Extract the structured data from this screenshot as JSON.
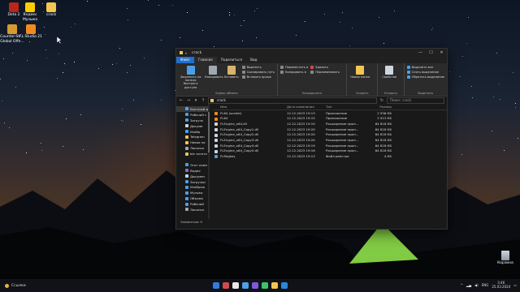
{
  "desktop": {
    "icons": [
      {
        "label": "Dota 2",
        "color": "#b8261c"
      },
      {
        "label": "Яндекс Музыка",
        "color": "#ffcc00"
      },
      {
        "label": "crack",
        "color": "#f3c64f"
      },
      {
        "label": "Counter-Str... Global Offe...",
        "color": "#d79a2e"
      },
      {
        "label": "FL Studio 21",
        "color": "#f08a1f"
      }
    ],
    "recycle_bin": "Корзина"
  },
  "window": {
    "title": "crack",
    "tabs": [
      "Файл",
      "Главная",
      "Поделиться",
      "Вид"
    ],
    "ribbon": {
      "clipboard": {
        "pin": "Закрепить на панели быстрого доступа",
        "copy": "Копировать",
        "paste": "Вставить",
        "cut": "Вырезать",
        "copy_path": "Скопировать путь",
        "paste_shortcut": "Вставить ярлык",
        "group": "Буфер обмена"
      },
      "organize": {
        "move_to": "Переместить в",
        "copy_to": "Копировать в",
        "delete": "Удалить",
        "rename": "Переименовать",
        "group": "Упорядочить"
      },
      "new": {
        "new_folder": "Новая папка",
        "group": "Создать"
      },
      "open": {
        "properties": "Свойства",
        "group": "Открыть"
      },
      "select": {
        "select_all": "Выделить все",
        "select_none": "Снять выделение",
        "invert": "Обратить выделение",
        "group": "Выделить"
      }
    },
    "address": {
      "path": "crack",
      "search_placeholder": "Поиск: crack"
    },
    "nav_pane": [
      {
        "label": "Быстрый д",
        "color": "#4fa3ff",
        "sel": true
      },
      {
        "label": "Рабочий с",
        "color": "#4aa0e8"
      },
      {
        "label": "Загрузк",
        "color": "#4aa0e8"
      },
      {
        "label": "Докуме",
        "color": "#cfd6de"
      },
      {
        "label": "Изобр",
        "color": "#4aa0e8"
      },
      {
        "label": "Telegram",
        "color": "#f3c64f"
      },
      {
        "label": "Новая па",
        "color": "#f3c64f"
      },
      {
        "label": "Локальн",
        "color": "#a0a8b0"
      },
      {
        "label": "bin загото",
        "color": "#f3c64f"
      },
      {
        "label": "",
        "color": "#191919"
      },
      {
        "label": "Этот комп",
        "color": "#4aa0e8"
      },
      {
        "label": "Видео",
        "color": "#8e6bd6"
      },
      {
        "label": "Докумен",
        "color": "#cfd6de"
      },
      {
        "label": "Загрузки",
        "color": "#4aa0e8"
      },
      {
        "label": "Изображ",
        "color": "#4aa0e8"
      },
      {
        "label": "Музыка",
        "color": "#4aa0e8"
      },
      {
        "label": "Объемн",
        "color": "#4aa0e8"
      },
      {
        "label": "Рабочий",
        "color": "#4aa0e8"
      },
      {
        "label": "Локальн",
        "color": "#a0a8b0"
      }
    ],
    "columns": {
      "name": "Имя",
      "date": "Дата изменения",
      "type": "Тип",
      "size": "Размер"
    },
    "files": [
      {
        "name": "FL64 (scaled)",
        "date": "12.12.2023 19:13",
        "type": "Приложение",
        "size": "2 936 КБ",
        "color": "#f08a1f"
      },
      {
        "name": "FL64",
        "date": "12.12.2023 19:15",
        "type": "Приложение",
        "size": "2 913 КБ",
        "color": "#f08a1f"
      },
      {
        "name": "FLEngine_x64.dll",
        "date": "12.12.2023 19:19",
        "type": "Расширение прил...",
        "size": "64 818 КБ",
        "color": "#cfd6de"
      },
      {
        "name": "FLEngine_x64_Copy1.dll",
        "date": "12.12.2023 19:20",
        "type": "Расширение прил...",
        "size": "64 818 КБ",
        "color": "#cfd6de"
      },
      {
        "name": "FLEngine_x64_Copy2.dll",
        "date": "12.12.2023 19:20",
        "type": "Расширение прил...",
        "size": "64 818 КБ",
        "color": "#cfd6de"
      },
      {
        "name": "FLEngine_x64_Copy3.dll",
        "date": "12.12.2023 19:20",
        "type": "Расширение прил...",
        "size": "64 818 КБ",
        "color": "#cfd6de"
      },
      {
        "name": "FLEngine_x64_Copy4.dll",
        "date": "12.12.2023 19:19",
        "type": "Расширение прил...",
        "size": "64 818 КБ",
        "color": "#cfd6de"
      },
      {
        "name": "FLEngine_x64_Copy5.dll",
        "date": "12.12.2023 19:16",
        "type": "Расширение прил...",
        "size": "64 818 КБ",
        "color": "#cfd6de"
      },
      {
        "name": "FLRegkey",
        "date": "12.12.2023 19:13",
        "type": "Файл реестра",
        "size": "4 КБ",
        "color": "#4aa0e8"
      }
    ],
    "status": "Элементов: 9"
  },
  "taskbar": {
    "weather": "Ссылки",
    "apps": [
      "#2f7de1",
      "#d14b4b",
      "#e8e8e8",
      "#4aa0e8",
      "#7a5ae0",
      "#3cc46d",
      "#f3c64f",
      "#2b88d8"
    ],
    "lang": "ENG",
    "time": "3:46",
    "date": "25.03.2024"
  }
}
